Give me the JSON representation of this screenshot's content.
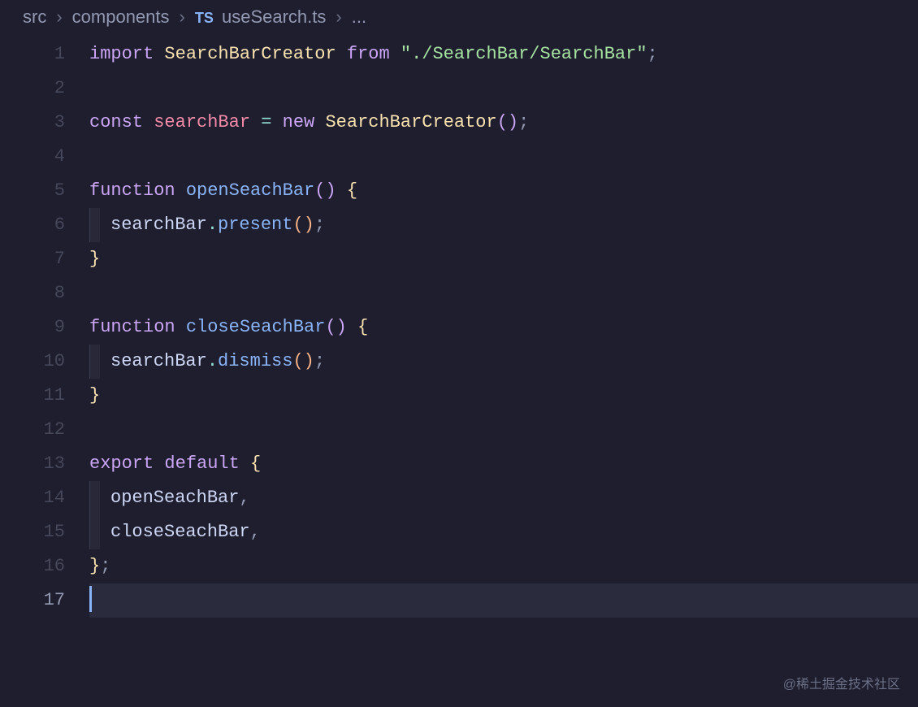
{
  "breadcrumbs": {
    "items": [
      "src",
      "components",
      "useSearch.ts",
      "..."
    ],
    "file_badge": "TS"
  },
  "editor": {
    "active_line": 17,
    "lines": [
      {
        "num": 1,
        "tokens": [
          {
            "t": "import",
            "c": "tk-keyword"
          },
          {
            "t": " ",
            "c": "tk-plain"
          },
          {
            "t": "SearchBarCreator",
            "c": "tk-class"
          },
          {
            "t": " ",
            "c": "tk-plain"
          },
          {
            "t": "from",
            "c": "tk-from"
          },
          {
            "t": " ",
            "c": "tk-plain"
          },
          {
            "t": "\"./SearchBar/SearchBar\"",
            "c": "tk-string"
          },
          {
            "t": ";",
            "c": "tk-semi"
          }
        ]
      },
      {
        "num": 2,
        "tokens": []
      },
      {
        "num": 3,
        "tokens": [
          {
            "t": "const",
            "c": "tk-const"
          },
          {
            "t": " ",
            "c": "tk-plain"
          },
          {
            "t": "searchBar",
            "c": "tk-var"
          },
          {
            "t": " ",
            "c": "tk-plain"
          },
          {
            "t": "=",
            "c": "tk-op"
          },
          {
            "t": " ",
            "c": "tk-plain"
          },
          {
            "t": "new",
            "c": "tk-new"
          },
          {
            "t": " ",
            "c": "tk-plain"
          },
          {
            "t": "SearchBarCreator",
            "c": "tk-class"
          },
          {
            "t": "()",
            "c": "tk-paren"
          },
          {
            "t": ";",
            "c": "tk-semi"
          }
        ]
      },
      {
        "num": 4,
        "tokens": []
      },
      {
        "num": 5,
        "tokens": [
          {
            "t": "function",
            "c": "tk-keyword"
          },
          {
            "t": " ",
            "c": "tk-plain"
          },
          {
            "t": "openSeachBar",
            "c": "tk-func"
          },
          {
            "t": "()",
            "c": "tk-paren"
          },
          {
            "t": " ",
            "c": "tk-plain"
          },
          {
            "t": "{",
            "c": "tk-brace"
          }
        ]
      },
      {
        "num": 6,
        "indent": true,
        "tokens": [
          {
            "t": "searchBar",
            "c": "tk-plain"
          },
          {
            "t": ".",
            "c": "tk-dot"
          },
          {
            "t": "present",
            "c": "tk-method"
          },
          {
            "t": "()",
            "c": "tk-paren2"
          },
          {
            "t": ";",
            "c": "tk-semi"
          }
        ]
      },
      {
        "num": 7,
        "tokens": [
          {
            "t": "}",
            "c": "tk-brace"
          }
        ]
      },
      {
        "num": 8,
        "tokens": []
      },
      {
        "num": 9,
        "tokens": [
          {
            "t": "function",
            "c": "tk-keyword"
          },
          {
            "t": " ",
            "c": "tk-plain"
          },
          {
            "t": "closeSeachBar",
            "c": "tk-func"
          },
          {
            "t": "()",
            "c": "tk-paren"
          },
          {
            "t": " ",
            "c": "tk-plain"
          },
          {
            "t": "{",
            "c": "tk-brace"
          }
        ]
      },
      {
        "num": 10,
        "indent": true,
        "tokens": [
          {
            "t": "searchBar",
            "c": "tk-plain"
          },
          {
            "t": ".",
            "c": "tk-dot"
          },
          {
            "t": "dismiss",
            "c": "tk-method"
          },
          {
            "t": "()",
            "c": "tk-paren2"
          },
          {
            "t": ";",
            "c": "tk-semi"
          }
        ]
      },
      {
        "num": 11,
        "tokens": [
          {
            "t": "}",
            "c": "tk-brace"
          }
        ]
      },
      {
        "num": 12,
        "tokens": []
      },
      {
        "num": 13,
        "tokens": [
          {
            "t": "export",
            "c": "tk-keyword"
          },
          {
            "t": " ",
            "c": "tk-plain"
          },
          {
            "t": "default",
            "c": "tk-keyword"
          },
          {
            "t": " ",
            "c": "tk-plain"
          },
          {
            "t": "{",
            "c": "tk-brace"
          }
        ]
      },
      {
        "num": 14,
        "indent": true,
        "tokens": [
          {
            "t": "openSeachBar",
            "c": "tk-plain"
          },
          {
            "t": ",",
            "c": "tk-semi"
          }
        ]
      },
      {
        "num": 15,
        "indent": true,
        "tokens": [
          {
            "t": "closeSeachBar",
            "c": "tk-plain"
          },
          {
            "t": ",",
            "c": "tk-semi"
          }
        ]
      },
      {
        "num": 16,
        "tokens": [
          {
            "t": "}",
            "c": "tk-brace"
          },
          {
            "t": ";",
            "c": "tk-semi"
          }
        ]
      },
      {
        "num": 17,
        "tokens": [],
        "cursor": true
      }
    ]
  },
  "watermark": "@稀土掘金技术社区"
}
